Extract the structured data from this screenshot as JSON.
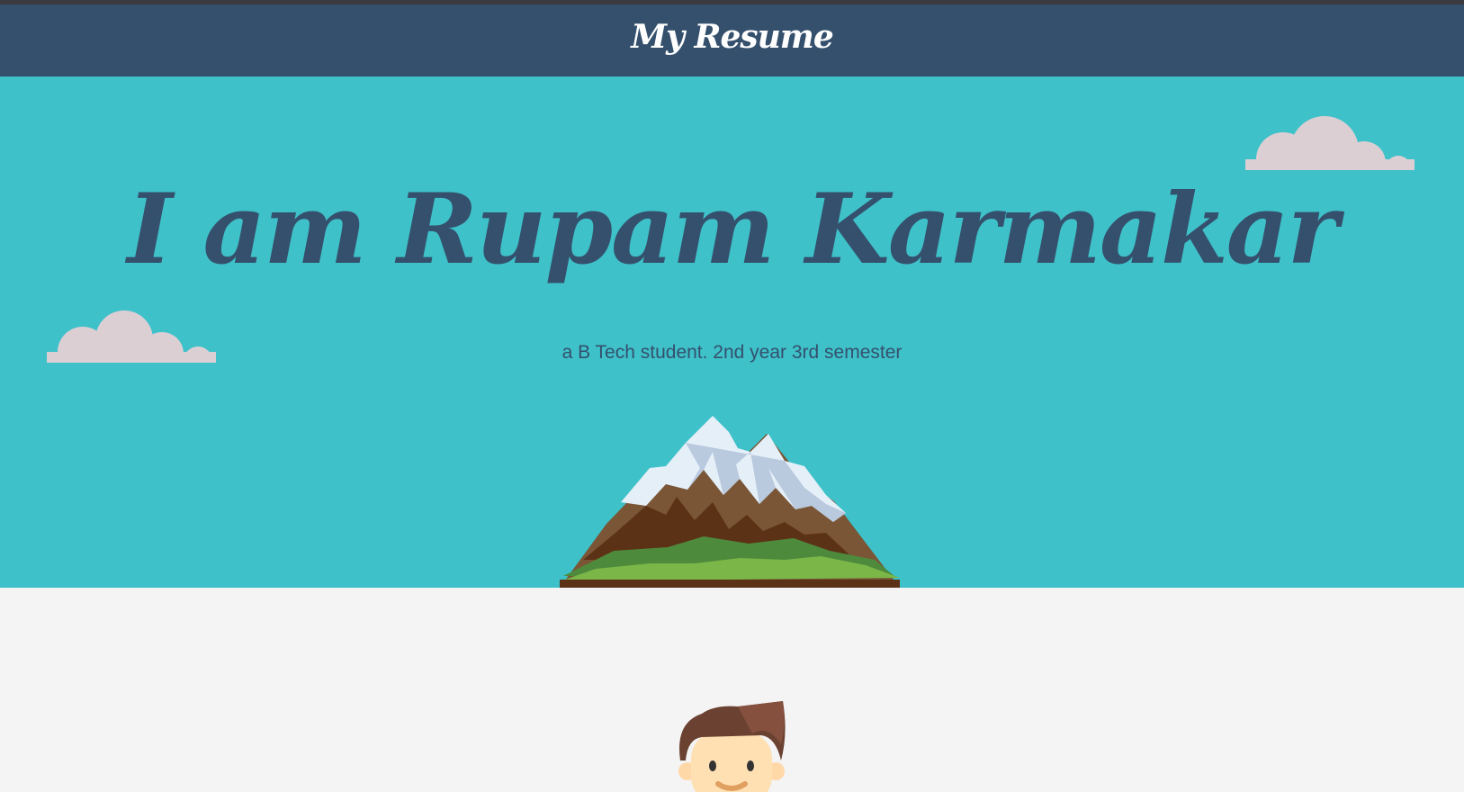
{
  "navbar": {
    "brand": "My Resume"
  },
  "hero": {
    "title": "I am Rupam Karmakar",
    "subtitle": "a B Tech student. 2nd year 3rd semester"
  },
  "colors": {
    "navbar_bg": "#35506d",
    "hero_bg": "#3ec1c9",
    "text_dark": "#35506d",
    "cloud": "#dccfd4",
    "page_bg": "#f4f4f4"
  },
  "icons": {
    "cloud": "cloud-icon",
    "mountain": "mountain-illustration",
    "avatar": "avatar-illustration"
  }
}
